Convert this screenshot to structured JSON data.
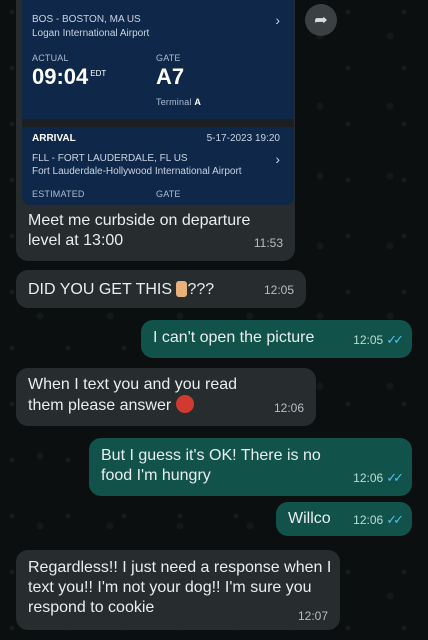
{
  "flight_card": {
    "origin": "BOS - BOSTON, MA US",
    "origin_airport": "Logan International Airport",
    "actual_label": "ACTUAL",
    "gate_label": "GATE",
    "departure_time": "09:04",
    "departure_tz": "EDT",
    "departure_gate": "A7",
    "terminal_label": "Terminal",
    "terminal": "A",
    "arrival_label": "ARRIVAL",
    "arrival_datetime": "5-17-2023 19:20",
    "destination": "FLL - FORT LAUDERDALE, FL US",
    "destination_airport": "Fort Lauderdale-Hollywood International Airport",
    "estimated_label": "ESTIMATED",
    "arrival_gate_label": "GATE"
  },
  "messages": [
    {
      "text": "Meet me curbside on departure level at 13:00",
      "time": "11:53",
      "direction": "in"
    },
    {
      "text_before": "DID YOU GET THIS",
      "text_after": "???",
      "time": "12:05",
      "direction": "in"
    },
    {
      "text": "I can't open the picture",
      "time": "12:05",
      "direction": "out",
      "status": "read"
    },
    {
      "text": "When I text you and you read them please answer",
      "time": "12:06",
      "direction": "in"
    },
    {
      "text": "But I guess it's OK! There is no food I'm hungry",
      "time": "12:06",
      "direction": "out",
      "status": "read"
    },
    {
      "text": "Willco",
      "time": "12:06",
      "direction": "out",
      "status": "read"
    },
    {
      "text": "Regardless!! I just need a response when I text you!! I'm not your dog!! I'm sure you respond to cookie",
      "time": "12:07",
      "direction": "in"
    }
  ],
  "icons": {
    "forward": "forward-arrow-icon",
    "read_receipt": "double-check-icon",
    "emoji_point": "backhand-index-pointing-up-emoji",
    "emoji_angry": "angry-face-emoji"
  },
  "colors": {
    "incoming_bubble": "#272c2f",
    "outgoing_bubble": "#11534b",
    "read_ticks": "#53bdeb",
    "flight_card": "#0f2748"
  }
}
